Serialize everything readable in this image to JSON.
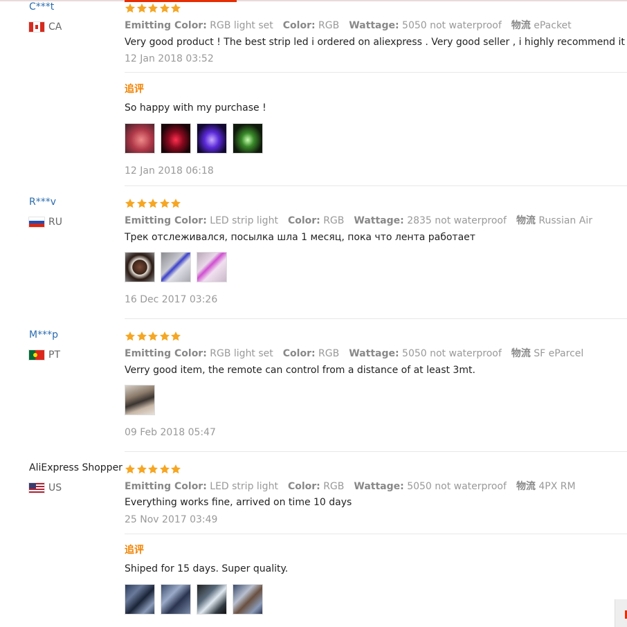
{
  "reviews": [
    {
      "user": "C***t",
      "country": "CA",
      "rating": 5,
      "attributes": [
        {
          "label": "Emitting Color:",
          "value": "RGB light set"
        },
        {
          "label": "Color:",
          "value": "RGB"
        },
        {
          "label": "Wattage:",
          "value": "5050 not waterproof"
        },
        {
          "label": "物流",
          "value": "ePacket"
        }
      ],
      "text": "Very good product ! The best strip led i ordered on aliexpress . Very good seller , i highly recommend it !",
      "date": "12 Jan 2018 03:52",
      "followup": {
        "label": "追评",
        "text": "So happy with my purchase !",
        "photos": [
          "led-photo-red-1",
          "led-photo-red-2",
          "led-photo-violet",
          "led-photo-green"
        ],
        "date": "12 Jan 2018 06:18"
      }
    },
    {
      "user": "R***v",
      "country": "RU",
      "rating": 5,
      "attributes": [
        {
          "label": "Emitting Color:",
          "value": "LED strip light"
        },
        {
          "label": "Color:",
          "value": "RGB"
        },
        {
          "label": "Wattage:",
          "value": "2835 not waterproof"
        },
        {
          "label": "物流",
          "value": "Russian Air"
        }
      ],
      "text": "Трек отслеживался, посылка шла 1 месяц, пока что лента работает",
      "photos": [
        "led-reel-photo",
        "ceiling-blue-photo",
        "ceiling-pink-photo"
      ],
      "date": "16 Dec 2017 03:26"
    },
    {
      "user": "M***p",
      "country": "PT",
      "rating": 5,
      "attributes": [
        {
          "label": "Emitting Color:",
          "value": "RGB light set"
        },
        {
          "label": "Color:",
          "value": "RGB"
        },
        {
          "label": "Wattage:",
          "value": "5050 not waterproof"
        },
        {
          "label": "物流",
          "value": "SF eParcel"
        }
      ],
      "text": "Verry good item, the remote can control from a distance of at least 3mt.",
      "photos": [
        "remote-photo"
      ],
      "date": "09 Feb 2018 05:47"
    },
    {
      "user": "AliExpress Shopper",
      "country": "US",
      "rating": 5,
      "attributes": [
        {
          "label": "Emitting Color:",
          "value": "LED strip light"
        },
        {
          "label": "Color:",
          "value": "RGB"
        },
        {
          "label": "Wattage:",
          "value": "5050 not waterproof"
        },
        {
          "label": "物流",
          "value": "4PX RM"
        }
      ],
      "text": "Everything works fine, arrived on time 10 days",
      "date": "25 Nov 2017 03:49",
      "followup": {
        "label": "追评",
        "text": "Shiped for 15 days. Super quality.",
        "photos": [
          "package-photo-1",
          "package-photo-2",
          "package-photo-3",
          "package-photo-4"
        ]
      }
    }
  ],
  "colors": {
    "star": "#f5a623",
    "accent": "#e62e04",
    "followup": "#f08200",
    "username": "#2b6cb0"
  }
}
